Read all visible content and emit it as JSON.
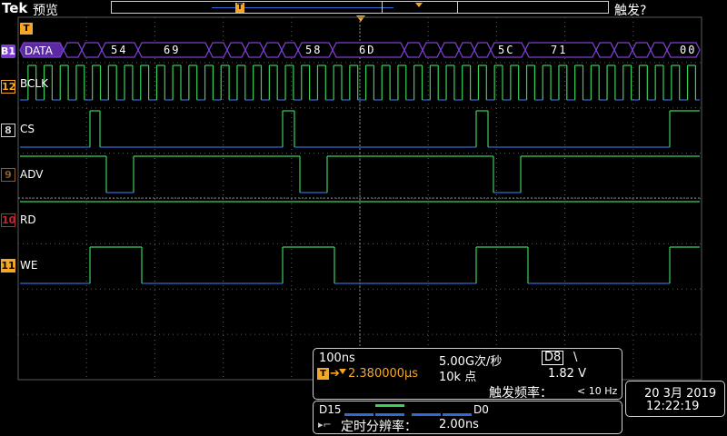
{
  "topbar": {
    "brand": "Tek",
    "mode": "预览",
    "trigger_status": "触发?"
  },
  "markers": {
    "trigger_marker": "T",
    "position_marker": "T"
  },
  "colors": {
    "grid": "#5a5a5a",
    "signal_high": "#3ad15a",
    "signal_low": "#2f6ad6",
    "bus": "#7c3fd0",
    "bus_fill": "#5b2aa3",
    "orange": "#f5a623",
    "red": "#c0282d",
    "brown": "#8a5a2b"
  },
  "channels": [
    {
      "id": "B1",
      "name": "DATA"
    },
    {
      "id": "12",
      "name": "BCLK"
    },
    {
      "id": "8",
      "name": "CS"
    },
    {
      "id": "9",
      "name": "ADV"
    },
    {
      "id": "10",
      "name": "RD"
    },
    {
      "id": "11",
      "name": "WE"
    }
  ],
  "bus_values": [
    "54",
    "69",
    "58",
    "6D",
    "5C",
    "71",
    "00"
  ],
  "acquisition": {
    "timebase": "100ns",
    "sample_rate": "5.00G次/秒",
    "trigger_source": "D8",
    "trigger_slope": "\\",
    "trigger_position": "2.380000µs",
    "record_length": "10k 点",
    "trigger_level": "1.82 V",
    "trigger_freq_label": "触发频率：",
    "trigger_freq_value": "< 10 Hz"
  },
  "digital": {
    "range_high": "D15",
    "range_low": "D0",
    "resolution_label": "定时分辨率：",
    "resolution_value": "2.00ns"
  },
  "clock": {
    "date": "20 3月 2019",
    "time": "12:22:19"
  }
}
